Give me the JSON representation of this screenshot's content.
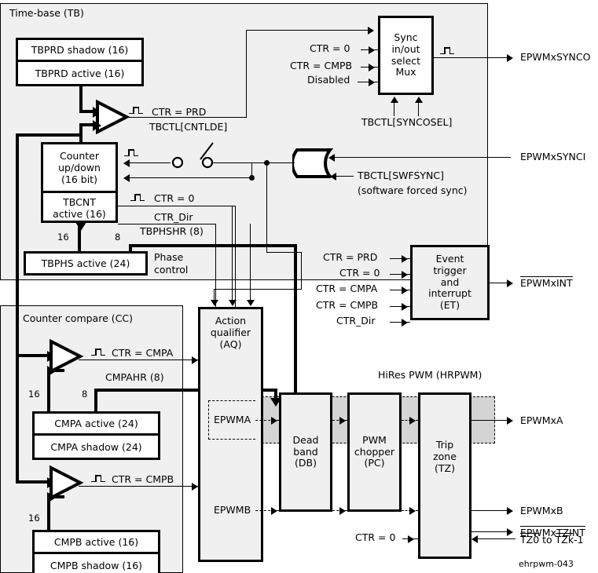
{
  "diagram": {
    "credit": "ehrpwm-043"
  },
  "regions": {
    "time_base": {
      "label": "Time-base (TB)"
    },
    "counter_compare": {
      "label": "Counter compare (CC)"
    },
    "hires": {
      "label": "HiRes PWM (HRPWM)"
    }
  },
  "time_base": {
    "tbprd_shadow": "TBPRD shadow (16)",
    "tbprd_active": "TBPRD active (16)",
    "counter_l1": "Counter",
    "counter_l2": "up/down",
    "counter_l3": "(16 bit)",
    "tbcnt_l1": "TBCNT",
    "tbcnt_l2": "active (16)",
    "tbphs_active": "TBPHS active (24)",
    "phase_l1": "Phase",
    "phase_l2": "control",
    "ctr_prd": "CTR = PRD",
    "ctr_zero": "CTR = 0",
    "ctr_dir": "CTR_Dir",
    "tbphshr": "TBPHSHR (8)",
    "cntlde": "TBCTL[CNTLDE]",
    "width_16": "16",
    "width_8": "8"
  },
  "sync": {
    "mux_l1": "Sync",
    "mux_l2": "in/out",
    "mux_l3": "select",
    "mux_l4": "Mux",
    "in_ctr0": "CTR = 0",
    "in_cmpb": "CTR = CMPB",
    "in_disabled": "Disabled",
    "syncosel": "TBCTL[SYNCOSEL]",
    "out_synco": "EPWMxSYNCO",
    "in_synci": "EPWMxSYNCI",
    "swfsync": "TBCTL[SWFSYNC]",
    "swfsync_note": "(software forced sync)"
  },
  "event_trigger": {
    "block_l1": "Event",
    "block_l2": "trigger",
    "block_l3": "and",
    "block_l4": "interrupt",
    "block_l5": "(ET)",
    "inputs": [
      "CTR = PRD",
      "CTR = 0",
      "CTR = CMPA",
      "CTR = CMPB",
      "CTR_Dir"
    ],
    "output": "EPWMxINT"
  },
  "counter_compare": {
    "ctr_cmpa": "CTR = CMPA",
    "ctr_cmpb": "CTR = CMPB",
    "cmpahr": "CMPAHR (8)",
    "cmpa_active": "CMPA active (24)",
    "cmpa_shadow": "CMPA shadow (24)",
    "cmpb_active": "CMPB active (16)",
    "cmpb_shadow": "CMPB shadow (16)",
    "width_16_a": "16",
    "width_8_a": "8",
    "width_16_b": "16"
  },
  "action_qualifier": {
    "l1": "Action",
    "l2": "qualifier",
    "l3": "(AQ)",
    "epwma": "EPWMA",
    "epwmb": "EPWMB"
  },
  "pipeline": {
    "dead_band": {
      "l1": "Dead",
      "l2": "band",
      "l3": "(DB)"
    },
    "pwm_chopper": {
      "l1": "PWM",
      "l2": "chopper",
      "l3": "(PC)"
    },
    "trip_zone": {
      "l1": "Trip",
      "l2": "zone",
      "l3": "(TZ)"
    },
    "tz_ctr0": "CTR = 0"
  },
  "outputs": {
    "epwmxa": "EPWMxA",
    "epwmxb": "EPWMxB",
    "epwmxtzint": "EPWMxTZINT",
    "tz_inputs_a": "TZ0",
    "tz_inputs_mid": " to ",
    "tz_inputs_b": "TZk",
    "tz_inputs_suffix": "-1"
  },
  "colors": {
    "region_fill": "#f0f0f0",
    "block_fill": "#f0f0f0",
    "hires_fill": "#d4d4d4",
    "stroke": "#000000",
    "page": "#ffffff"
  }
}
